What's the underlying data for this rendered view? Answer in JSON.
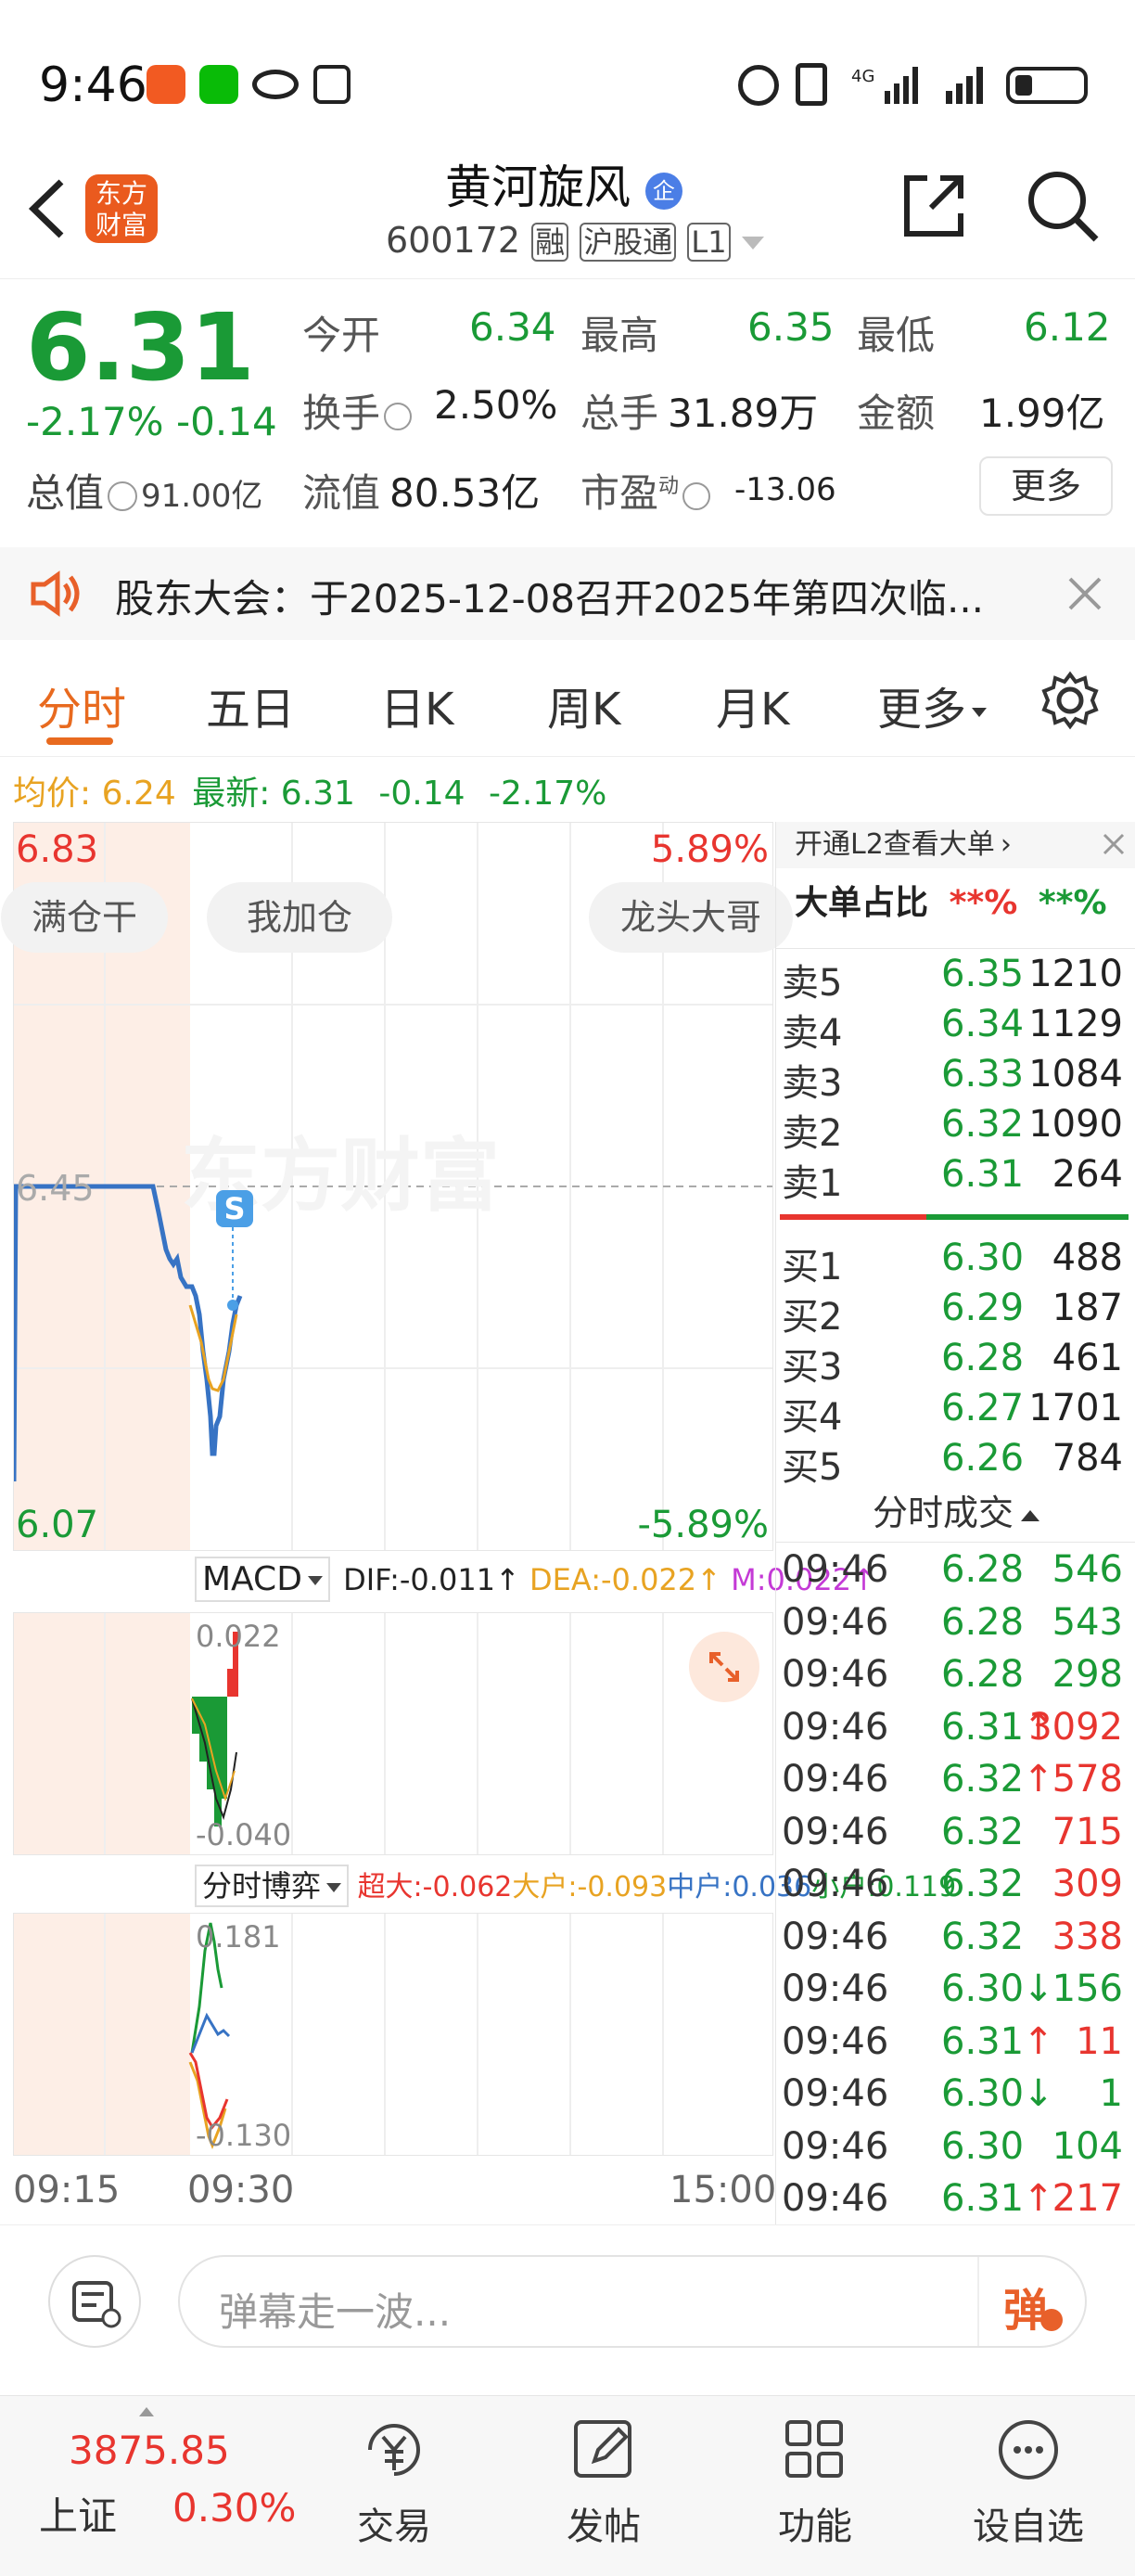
{
  "status": {
    "time": "9:46"
  },
  "header": {
    "stock_name": "黄河旋风",
    "code": "600172",
    "tag_rong": "融",
    "tag_hgt": "沪股通",
    "tag_l1": "L1",
    "logo_text_1": "东方",
    "logo_text_2": "财富",
    "badge": "企"
  },
  "quote": {
    "price": "6.31",
    "change_pct": "-2.17%",
    "change": "-0.14",
    "labels": {
      "open": "今开",
      "high": "最高",
      "low": "最低",
      "turnover": "换手",
      "volume": "总手",
      "amount": "金额",
      "mktcap": "总值",
      "float": "流值",
      "pe": "市盈",
      "pe_sup": "动",
      "more": "更多"
    },
    "values": {
      "open": "6.34",
      "high": "6.35",
      "low": "6.12",
      "turnover": "2.50%",
      "volume": "31.89万",
      "amount": "1.99亿",
      "mktcap": "91.00亿",
      "float": "80.53亿",
      "pe": "-13.06"
    }
  },
  "notice": {
    "text": "股东大会：于2025-12-08召开2025年第四次临..."
  },
  "tabs": [
    "分时",
    "五日",
    "日K",
    "周K",
    "月K",
    "更多"
  ],
  "chart_header": {
    "avg_label": "均价:",
    "avg": "6.24",
    "latest_label": "最新:",
    "latest": "6.31",
    "chg": "-0.14",
    "pct": "-2.17%"
  },
  "chart": {
    "top_price": "6.83",
    "top_pct": "5.89%",
    "bottom_price": "6.07",
    "bottom_pct": "-5.89%",
    "mid_price": "6.45",
    "danmu": [
      "满仓干",
      "我加仓",
      "龙头大哥"
    ],
    "watermark": "东方财富",
    "s_marker": "S"
  },
  "macd": {
    "label": "MACD",
    "dif": "DIF:-0.011",
    "dea": "DEA:-0.022",
    "m": "M:0.022",
    "top": "0.022",
    "bottom": "-0.040"
  },
  "game": {
    "label": "分时博弈",
    "chaoda": "超大:-0.062",
    "dahu": "大户:-0.093",
    "zhonghu": "中户:0.036",
    "xiaohu": "小户:0.119",
    "top": "0.181",
    "bottom": "-0.130"
  },
  "time_axis": [
    "09:15",
    "09:30",
    "15:00"
  ],
  "l2": {
    "promo": "开通L2查看大单",
    "ratio_label": "大单占比",
    "ratio_red": "**%",
    "ratio_green": "**%"
  },
  "orderbook": {
    "asks": [
      {
        "label": "卖5",
        "price": "6.35",
        "vol": "1210"
      },
      {
        "label": "卖4",
        "price": "6.34",
        "vol": "1129"
      },
      {
        "label": "卖3",
        "price": "6.33",
        "vol": "1084"
      },
      {
        "label": "卖2",
        "price": "6.32",
        "vol": "1090"
      },
      {
        "label": "卖1",
        "price": "6.31",
        "vol": "264"
      }
    ],
    "bids": [
      {
        "label": "买1",
        "price": "6.30",
        "vol": "488"
      },
      {
        "label": "买2",
        "price": "6.29",
        "vol": "187"
      },
      {
        "label": "买3",
        "price": "6.28",
        "vol": "461"
      },
      {
        "label": "买4",
        "price": "6.27",
        "vol": "1701"
      },
      {
        "label": "买5",
        "price": "6.26",
        "vol": "784"
      }
    ]
  },
  "ticks_title": "分时成交",
  "ticks": [
    {
      "time": "09:46",
      "price": "6.28",
      "arrow": "",
      "vol": "546",
      "vol_color": "green"
    },
    {
      "time": "09:46",
      "price": "6.28",
      "arrow": "",
      "vol": "543",
      "vol_color": "green"
    },
    {
      "time": "09:46",
      "price": "6.28",
      "arrow": "",
      "vol": "298",
      "vol_color": "green"
    },
    {
      "time": "09:46",
      "price": "6.31",
      "arrow": "↑",
      "vol": "3092",
      "vol_color": "red"
    },
    {
      "time": "09:46",
      "price": "6.32",
      "arrow": "↑",
      "vol": "578",
      "vol_color": "red"
    },
    {
      "time": "09:46",
      "price": "6.32",
      "arrow": "",
      "vol": "715",
      "vol_color": "red"
    },
    {
      "time": "09:46",
      "price": "6.32",
      "arrow": "",
      "vol": "309",
      "vol_color": "red"
    },
    {
      "time": "09:46",
      "price": "6.32",
      "arrow": "",
      "vol": "338",
      "vol_color": "red"
    },
    {
      "time": "09:46",
      "price": "6.30",
      "arrow": "↓",
      "vol": "156",
      "vol_color": "green"
    },
    {
      "time": "09:46",
      "price": "6.31",
      "arrow": "↑",
      "vol": "11",
      "vol_color": "red"
    },
    {
      "time": "09:46",
      "price": "6.30",
      "arrow": "↓",
      "vol": "1",
      "vol_color": "green"
    },
    {
      "time": "09:46",
      "price": "6.30",
      "arrow": "",
      "vol": "104",
      "vol_color": "green"
    },
    {
      "time": "09:46",
      "price": "6.31",
      "arrow": "↑",
      "vol": "217",
      "vol_color": "red"
    }
  ],
  "comment": {
    "placeholder": "弹幕走一波...",
    "send": "弹"
  },
  "bottom_nav": {
    "index_value": "3875.85",
    "index_name": "上证",
    "index_pct": "0.30%",
    "items": [
      "交易",
      "发帖",
      "功能",
      "设自选"
    ]
  }
}
